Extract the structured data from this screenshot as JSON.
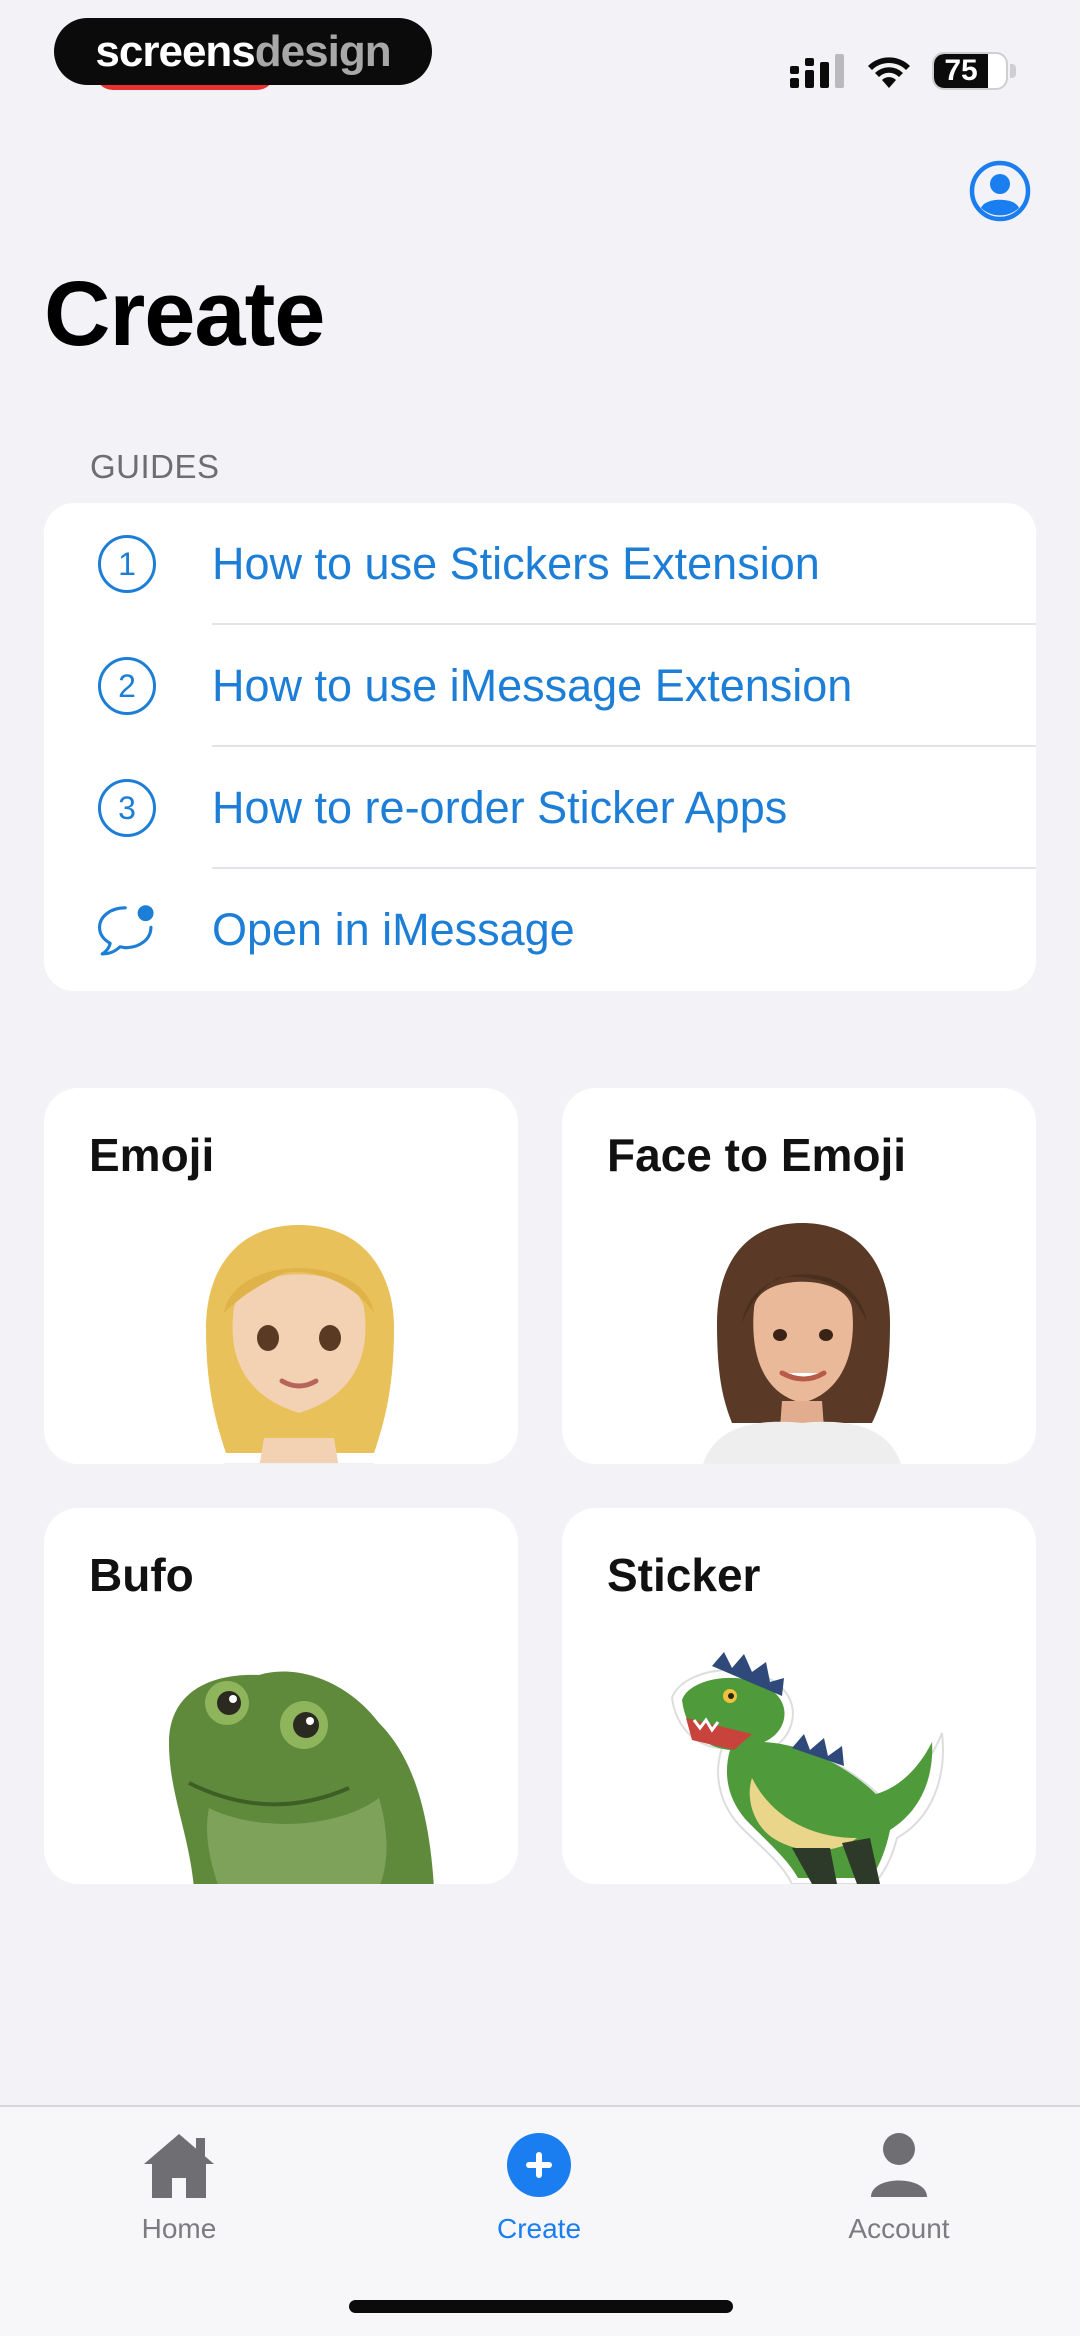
{
  "status_bar": {
    "watermark_part1": "screens",
    "watermark_part2": "design",
    "battery_level": "75",
    "icons": [
      "signal-icon",
      "wifi-icon",
      "battery-icon"
    ]
  },
  "header": {
    "title": "Create",
    "profile_icon": "profile-icon"
  },
  "guides": {
    "header": "GUIDES",
    "items": [
      {
        "number": "1",
        "label": "How to use Stickers Extension"
      },
      {
        "number": "2",
        "label": "How to use iMessage Extension"
      },
      {
        "number": "3",
        "label": "How to re-order Sticker Apps"
      },
      {
        "icon": "message-bubble-icon",
        "label": "Open in iMessage"
      }
    ]
  },
  "cards": [
    {
      "title": "Emoji",
      "image": "blonde-woman-emoji"
    },
    {
      "title": "Face to Emoji",
      "image": "brunette-woman-portrait"
    },
    {
      "title": "Bufo",
      "image": "frog-bufo"
    },
    {
      "title": "Sticker",
      "image": "dinosaur-sticker"
    }
  ],
  "tab_bar": {
    "tabs": [
      {
        "label": "Home",
        "icon": "house-icon"
      },
      {
        "label": "Create",
        "icon": "plus-circle-icon",
        "active": true
      },
      {
        "label": "Account",
        "icon": "person-icon"
      }
    ]
  },
  "colors": {
    "accent": "#1c7ed6",
    "tab_active": "#1a7ef0",
    "background": "#f2f2f7"
  }
}
